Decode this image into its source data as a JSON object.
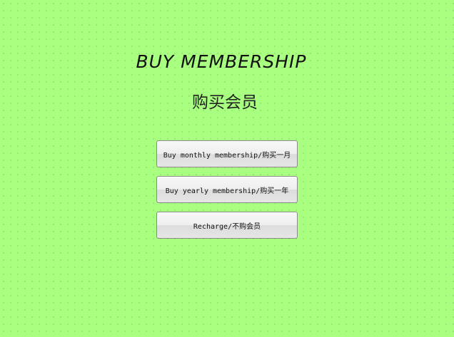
{
  "page": {
    "title_en": "BUY MEMBERSHIP",
    "title_cn": "购买会员"
  },
  "buttons": {
    "monthly": "Buy monthly membership/购买一月",
    "yearly": "Buy yearly membership/购买一年",
    "recharge": "Recharge/不购会员"
  },
  "colors": {
    "background": "#a8ff80"
  }
}
